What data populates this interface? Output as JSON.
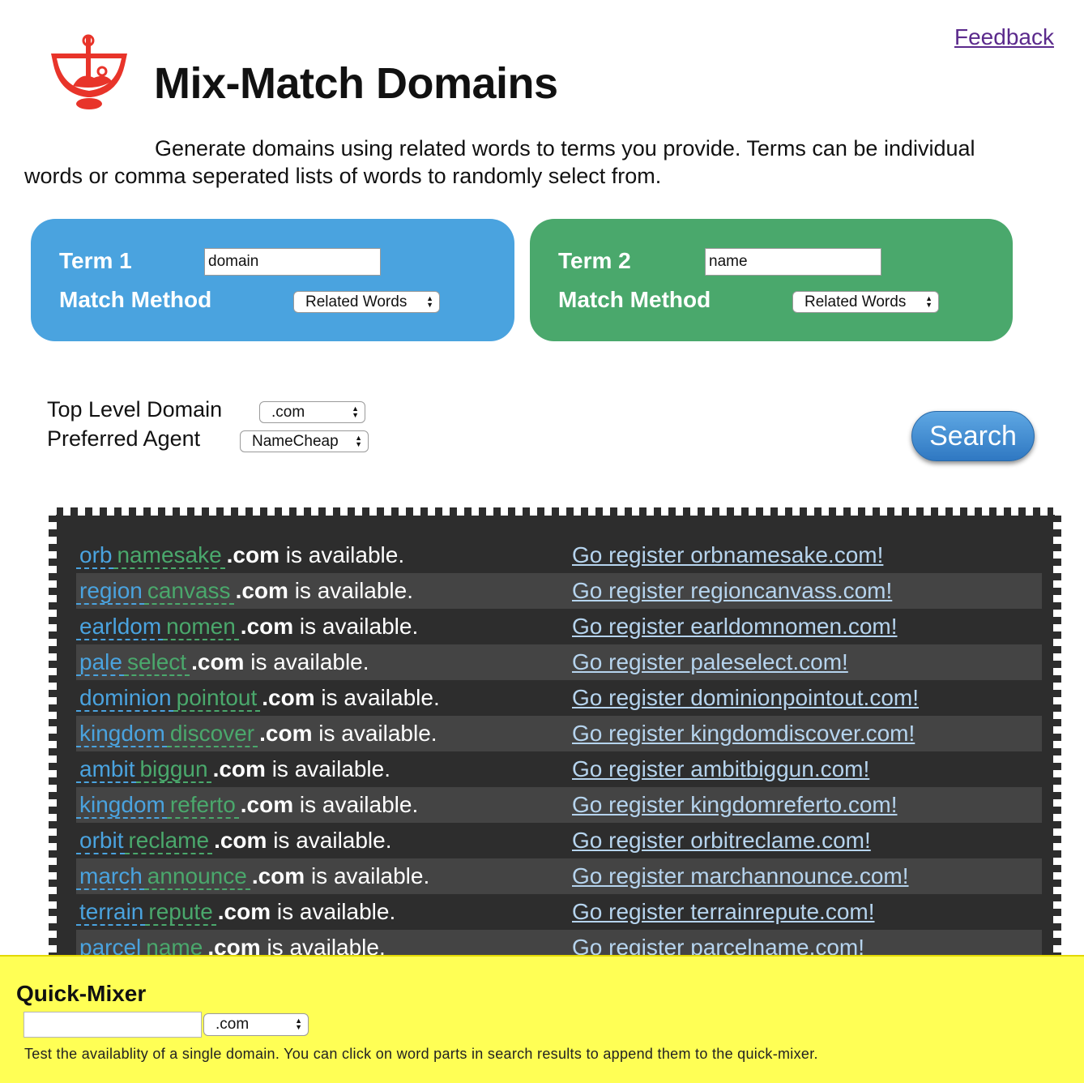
{
  "header": {
    "feedback_label": "Feedback",
    "title": "Mix-Match Domains",
    "intro": "Generate domains using related words to terms you provide. Terms can be individual words or comma seperated lists of words to randomly select from."
  },
  "term1": {
    "label": "Term 1",
    "value": "domain",
    "method_label": "Match Method",
    "method_value": "Related Words",
    "color": "#4aa3df"
  },
  "term2": {
    "label": "Term 2",
    "value": "name",
    "method_label": "Match Method",
    "method_value": "Related Words",
    "color": "#4aa86c"
  },
  "options": {
    "tld_label": "Top Level Domain",
    "tld_value": ".com",
    "agent_label": "Preferred Agent",
    "agent_value": "NameCheap"
  },
  "search_label": "Search",
  "results": [
    {
      "w1": "orb",
      "w2": "namesake",
      "tld": ".com",
      "status": " is available.",
      "link": "Go register orbnamesake.com!"
    },
    {
      "w1": "region",
      "w2": "canvass",
      "tld": ".com",
      "status": " is available.",
      "link": "Go register regioncanvass.com!"
    },
    {
      "w1": "earldom",
      "w2": "nomen",
      "tld": ".com",
      "status": " is available.",
      "link": "Go register earldomnomen.com!"
    },
    {
      "w1": "pale",
      "w2": "select",
      "tld": ".com",
      "status": " is available.",
      "link": "Go register paleselect.com!"
    },
    {
      "w1": "dominion",
      "w2": "pointout",
      "tld": ".com",
      "status": " is available.",
      "link": "Go register dominionpointout.com!"
    },
    {
      "w1": "kingdom",
      "w2": "discover",
      "tld": ".com",
      "status": " is available.",
      "link": "Go register kingdomdiscover.com!"
    },
    {
      "w1": "ambit",
      "w2": "biggun",
      "tld": ".com",
      "status": " is available.",
      "link": "Go register ambitbiggun.com!"
    },
    {
      "w1": "kingdom",
      "w2": "referto",
      "tld": ".com",
      "status": " is available.",
      "link": "Go register kingdomreferto.com!"
    },
    {
      "w1": "orbit",
      "w2": "reclame",
      "tld": ".com",
      "status": " is available.",
      "link": "Go register orbitreclame.com!"
    },
    {
      "w1": "march",
      "w2": "announce",
      "tld": ".com",
      "status": " is available.",
      "link": "Go register marchannounce.com!"
    },
    {
      "w1": "terrain",
      "w2": "repute",
      "tld": ".com",
      "status": " is available.",
      "link": "Go register terrainrepute.com!"
    },
    {
      "w1": "parcel",
      "w2": "name",
      "tld": ".com",
      "status": " is available.",
      "link": "Go register parcelname.com!"
    }
  ],
  "quick_mixer": {
    "title": "Quick-Mixer",
    "input_value": "",
    "tld_value": ".com",
    "help": "Test the availablity of a single domain. You can click on word parts in search results to append them to the quick-mixer."
  }
}
